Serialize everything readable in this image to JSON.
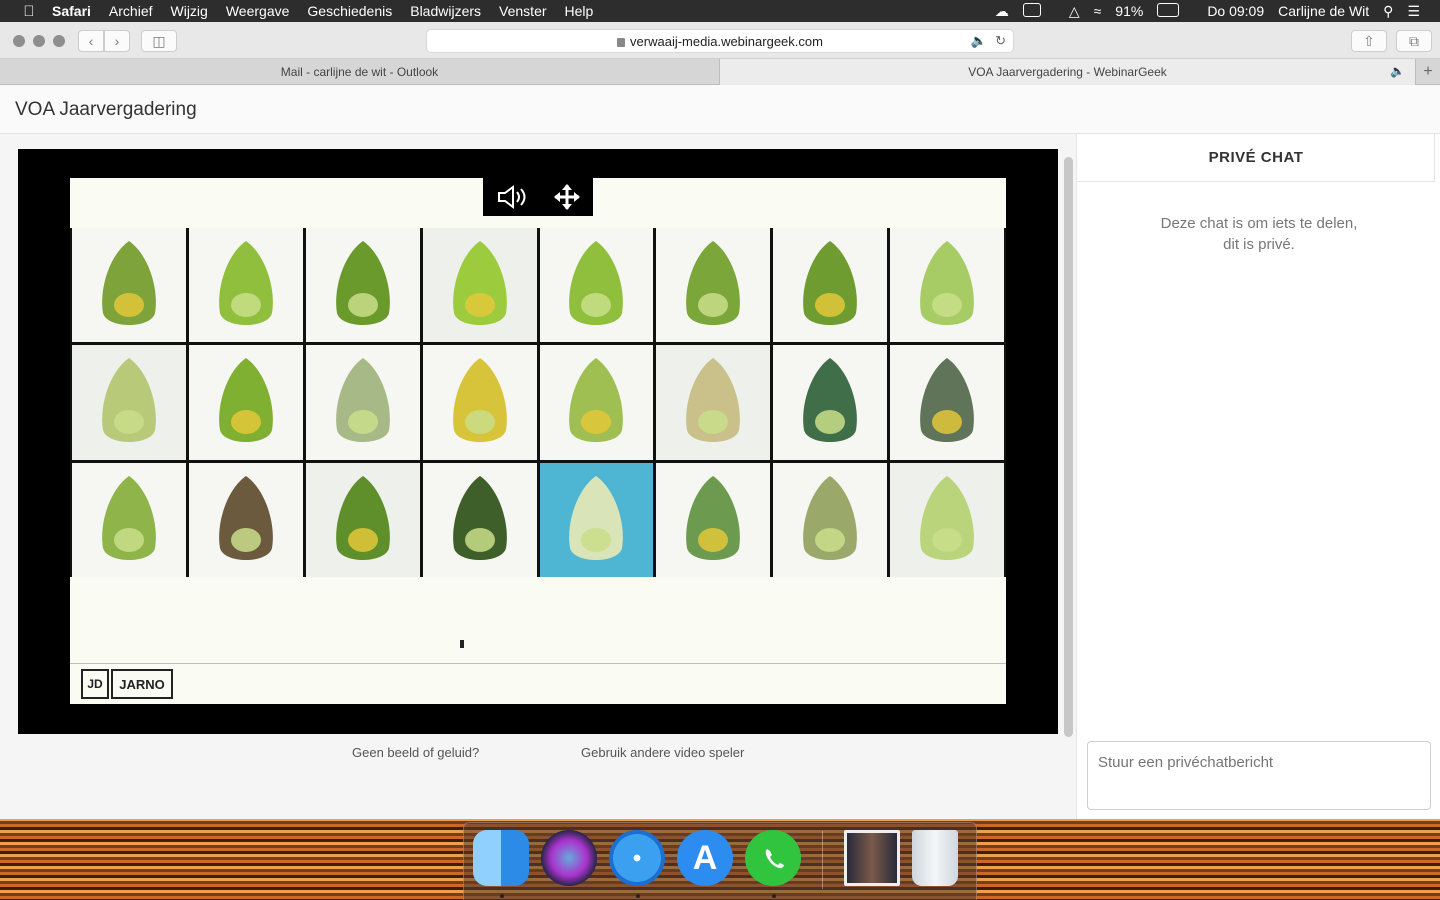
{
  "menubar": {
    "app": "Safari",
    "items": [
      "Archief",
      "Wijzig",
      "Weergave",
      "Geschiedenis",
      "Bladwijzers",
      "Venster",
      "Help"
    ],
    "battery": "91%",
    "clock": "Do 09:09",
    "user": "Carlijne de Wit"
  },
  "browser": {
    "url": "verwaaij-media.webinargeek.com",
    "tabs": [
      {
        "title": "Mail - carlijne de wit - Outlook",
        "active": false
      },
      {
        "title": "VOA Jaarvergadering - WebinarGeek",
        "active": true
      }
    ],
    "new_tab": "+"
  },
  "page": {
    "title": "VOA Jaarvergadering",
    "video": {
      "slide_logo_mark": "JD",
      "slide_logo_text": "JARNO",
      "grid_colors": [
        "#7da33a",
        "#8fbf3c",
        "#6a9a2c",
        "#9ccc3e",
        "#8fbf3c",
        "#7aa63a",
        "#6f9c30",
        "#a7cc66",
        "#b9c97a",
        "#7fb032",
        "#a7b987",
        "#d8c43a",
        "#9fbf52",
        "#c9c08a",
        "#3f6e48",
        "#5f7458",
        "#8fb44a",
        "#6b5a3e",
        "#5f8f2a",
        "#3f5f2a",
        "#4eb6d3",
        "#6c9a4e",
        "#9aa86a",
        "#b9d47a"
      ]
    },
    "links": {
      "no_media": "Geen beeld of geluid?",
      "other_player": "Gebruik andere video speler"
    },
    "chat": {
      "title": "PRIVÉ CHAT",
      "info_line1": "Deze chat is om iets te delen,",
      "info_line2": "dit is privé.",
      "placeholder": "Stuur een privéchatbericht"
    }
  },
  "dock": {
    "apps": [
      "finder-icon",
      "siri-icon",
      "safari-icon",
      "app-store-icon",
      "whatsapp-icon",
      "photo-stack-icon",
      "trash-icon"
    ]
  }
}
